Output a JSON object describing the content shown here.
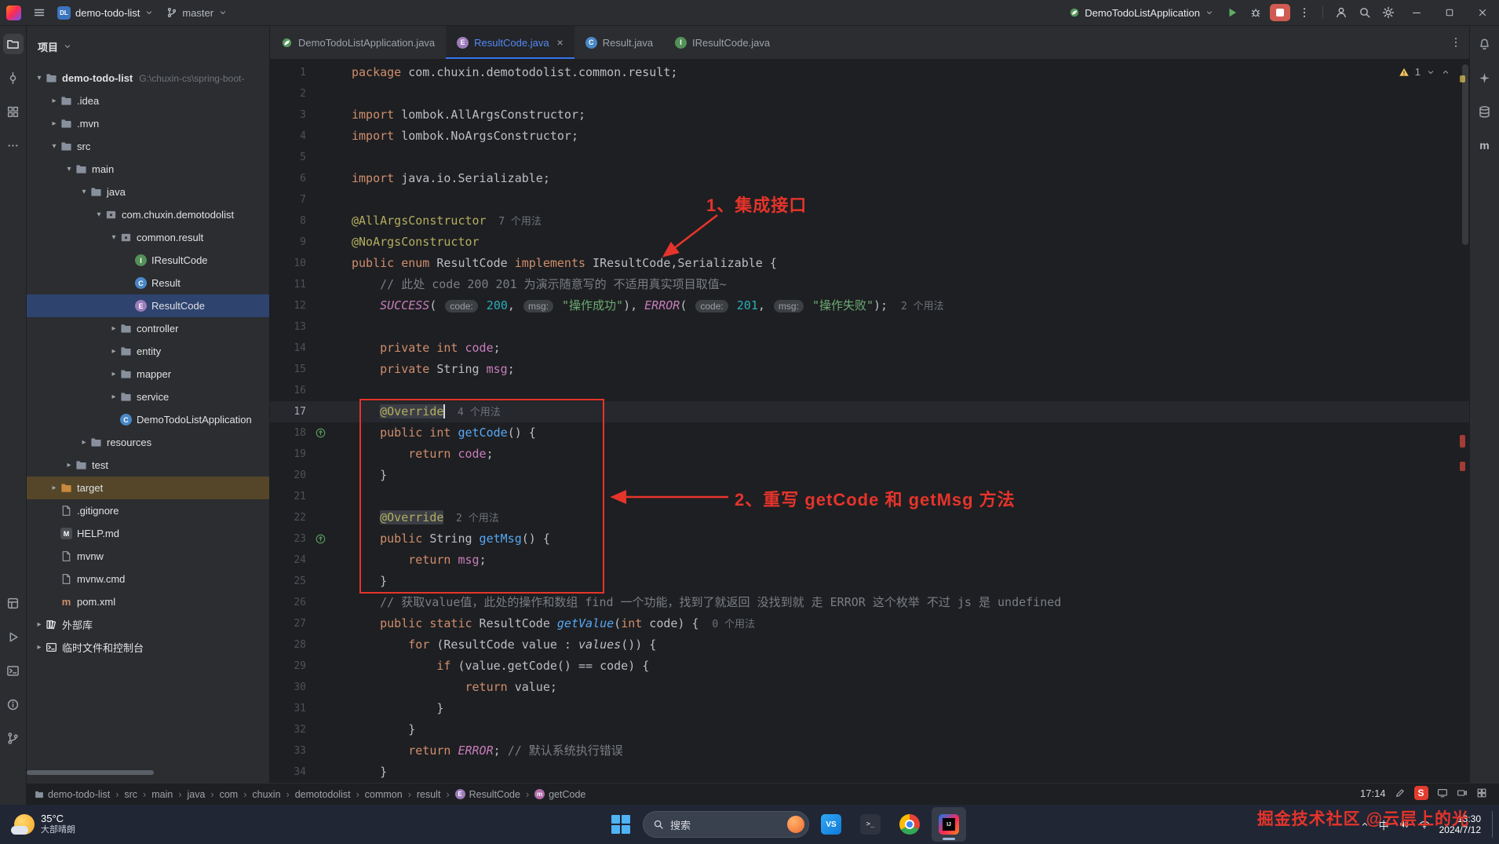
{
  "titlebar": {
    "project_badge": "DL",
    "project_name": "demo-todo-list",
    "branch": "master",
    "run_config": "DemoTodoListApplication"
  },
  "left_toolbar": {
    "top": [
      "project",
      "commit",
      "structure",
      "more"
    ],
    "bottom": [
      "services",
      "run",
      "terminal",
      "problems",
      "version-control"
    ]
  },
  "right_toolbar": {
    "top": [
      "notifications",
      "ai-assistant",
      "database",
      "maven"
    ],
    "maven_label": "m"
  },
  "project_panel": {
    "title": "项目",
    "tree": [
      {
        "label": "demo-todo-list",
        "path": "G:\\chuxin-cs\\spring-boot-",
        "depth": 0,
        "chev": "open",
        "icon": "folder",
        "bold": true
      },
      {
        "label": ".idea",
        "depth": 1,
        "chev": "closed",
        "icon": "folder"
      },
      {
        "label": ".mvn",
        "depth": 1,
        "chev": "closed",
        "icon": "folder"
      },
      {
        "label": "src",
        "depth": 1,
        "chev": "open",
        "icon": "folder"
      },
      {
        "label": "main",
        "depth": 2,
        "chev": "open",
        "icon": "folder"
      },
      {
        "label": "java",
        "depth": 3,
        "chev": "open",
        "icon": "folder"
      },
      {
        "label": "com.chuxin.demotodolist",
        "depth": 4,
        "chev": "open",
        "icon": "package"
      },
      {
        "label": "common.result",
        "depth": 5,
        "chev": "open",
        "icon": "package"
      },
      {
        "label": "IResultCode",
        "depth": 6,
        "icon": "interface"
      },
      {
        "label": "Result",
        "depth": 6,
        "icon": "class"
      },
      {
        "label": "ResultCode",
        "depth": 6,
        "icon": "enum",
        "selected": true
      },
      {
        "label": "controller",
        "depth": 5,
        "chev": "closed",
        "icon": "folder"
      },
      {
        "label": "entity",
        "depth": 5,
        "chev": "closed",
        "icon": "folder"
      },
      {
        "label": "mapper",
        "depth": 5,
        "chev": "closed",
        "icon": "folder"
      },
      {
        "label": "service",
        "depth": 5,
        "chev": "closed",
        "icon": "folder"
      },
      {
        "label": "DemoTodoListApplication",
        "depth": 5,
        "icon": "class"
      },
      {
        "label": "resources",
        "depth": 3,
        "chev": "closed",
        "icon": "folder"
      },
      {
        "label": "test",
        "depth": 2,
        "chev": "closed",
        "icon": "folder"
      },
      {
        "label": "target",
        "depth": 1,
        "chev": "closed",
        "icon": "folder",
        "variant": "target"
      },
      {
        "label": ".gitignore",
        "depth": 1,
        "icon": "file"
      },
      {
        "label": "HELP.md",
        "depth": 1,
        "icon": "md"
      },
      {
        "label": "mvnw",
        "depth": 1,
        "icon": "file"
      },
      {
        "label": "mvnw.cmd",
        "depth": 1,
        "icon": "file"
      },
      {
        "label": "pom.xml",
        "depth": 1,
        "icon": "maven"
      },
      {
        "label": "外部库",
        "depth": 0,
        "chev": "closed",
        "icon": "lib"
      },
      {
        "label": "临时文件和控制台",
        "depth": 0,
        "chev": "closed",
        "icon": "console"
      }
    ]
  },
  "editor": {
    "tabs": [
      {
        "label": "DemoTodoListApplication.java",
        "icon": "spring"
      },
      {
        "label": "ResultCode.java",
        "icon": "enum",
        "active": true
      },
      {
        "label": "Result.java",
        "icon": "class"
      },
      {
        "label": "IResultCode.java",
        "icon": "interface"
      }
    ],
    "inspection": {
      "warning_count": "1"
    },
    "annotations": {
      "label1": "1、集成接口",
      "label2": "2、重写 getCode 和 getMsg 方法"
    },
    "lines": [
      {
        "n": 1,
        "t": [
          [
            "kw",
            "package"
          ],
          [
            "pl",
            " com.chuxin.demotodolist.common.result;"
          ]
        ]
      },
      {
        "n": 2,
        "t": []
      },
      {
        "n": 3,
        "t": [
          [
            "kw",
            "import"
          ],
          [
            "pl",
            " lombok.AllArgsConstructor;"
          ]
        ]
      },
      {
        "n": 4,
        "t": [
          [
            "kw",
            "import"
          ],
          [
            "pl",
            " lombok.NoArgsConstructor;"
          ]
        ]
      },
      {
        "n": 5,
        "t": []
      },
      {
        "n": 6,
        "t": [
          [
            "kw",
            "import"
          ],
          [
            "pl",
            " java.io.Serializable;"
          ]
        ]
      },
      {
        "n": 7,
        "t": []
      },
      {
        "n": 8,
        "t": [
          [
            "an",
            "@AllArgsConstructor"
          ],
          [
            "us",
            "  7 个用法"
          ]
        ]
      },
      {
        "n": 9,
        "t": [
          [
            "an",
            "@NoArgsConstructor"
          ]
        ]
      },
      {
        "n": 10,
        "t": [
          [
            "kw",
            "public enum"
          ],
          [
            "pl",
            " ResultCode "
          ],
          [
            "kw",
            "implements"
          ],
          [
            "pl",
            " IResultCode,Serializable {"
          ]
        ]
      },
      {
        "n": 11,
        "t": [
          [
            "pl",
            "    "
          ],
          [
            "cm",
            "// 此处 code 200 201 为演示随意写的 不适用真实项目取值~"
          ]
        ]
      },
      {
        "n": 12,
        "t": [
          [
            "pl",
            "    "
          ],
          [
            "en",
            "SUCCESS"
          ],
          [
            "pl",
            "( "
          ],
          [
            "ih",
            "code:"
          ],
          [
            "nm",
            " 200"
          ],
          [
            "pl",
            ", "
          ],
          [
            "ih",
            "msg:"
          ],
          [
            "st",
            " \"操作成功\""
          ],
          [
            "pl",
            "), "
          ],
          [
            "en",
            "ERROR"
          ],
          [
            "pl",
            "( "
          ],
          [
            "ih",
            "code:"
          ],
          [
            "nm",
            " 201"
          ],
          [
            "pl",
            ", "
          ],
          [
            "ih",
            "msg:"
          ],
          [
            "st",
            " \"操作失败\""
          ],
          [
            "pl",
            "); "
          ],
          [
            "us",
            " 2 个用法"
          ]
        ]
      },
      {
        "n": 13,
        "t": []
      },
      {
        "n": 14,
        "t": [
          [
            "pl",
            "    "
          ],
          [
            "kw",
            "private int"
          ],
          [
            "fd",
            " code"
          ],
          [
            "pl",
            ";"
          ]
        ]
      },
      {
        "n": 15,
        "t": [
          [
            "pl",
            "    "
          ],
          [
            "kw",
            "private"
          ],
          [
            "pl",
            " String"
          ],
          [
            "fd",
            " msg"
          ],
          [
            "pl",
            ";"
          ]
        ]
      },
      {
        "n": 16,
        "t": []
      },
      {
        "n": 17,
        "cur": true,
        "t": [
          [
            "pl",
            "    "
          ],
          [
            "anhl",
            "@Override"
          ],
          [
            "caret",
            ""
          ],
          [
            "us",
            "  4 个用法"
          ]
        ]
      },
      {
        "n": 18,
        "g": "override",
        "t": [
          [
            "pl",
            "    "
          ],
          [
            "kw",
            "public int"
          ],
          [
            "mt",
            " getCode"
          ],
          [
            "pl",
            "() {"
          ]
        ]
      },
      {
        "n": 19,
        "t": [
          [
            "pl",
            "        "
          ],
          [
            "kw",
            "return"
          ],
          [
            "fd",
            " code"
          ],
          [
            "pl",
            ";"
          ]
        ]
      },
      {
        "n": 20,
        "t": [
          [
            "pl",
            "    }"
          ]
        ]
      },
      {
        "n": 21,
        "t": []
      },
      {
        "n": 22,
        "t": [
          [
            "pl",
            "    "
          ],
          [
            "anhl",
            "@Override"
          ],
          [
            "us",
            "  2 个用法"
          ]
        ]
      },
      {
        "n": 23,
        "g": "override",
        "t": [
          [
            "pl",
            "    "
          ],
          [
            "kw",
            "public"
          ],
          [
            "pl",
            " String"
          ],
          [
            "mt",
            " getMsg"
          ],
          [
            "pl",
            "() {"
          ]
        ]
      },
      {
        "n": 24,
        "t": [
          [
            "pl",
            "        "
          ],
          [
            "kw",
            "return"
          ],
          [
            "fd",
            " msg"
          ],
          [
            "pl",
            ";"
          ]
        ]
      },
      {
        "n": 25,
        "t": [
          [
            "pl",
            "    }"
          ]
        ]
      },
      {
        "n": 26,
        "t": [
          [
            "pl",
            "    "
          ],
          [
            "cm",
            "// 获取value值，此处的操作和数组 find 一个功能，找到了就返回 没找到就 走 ERROR 这个枚举 不过 js 是 undefined"
          ]
        ]
      },
      {
        "n": 27,
        "t": [
          [
            "pl",
            "    "
          ],
          [
            "kw",
            "public static"
          ],
          [
            "pl",
            " ResultCode "
          ],
          [
            "mti",
            "getValue"
          ],
          [
            "pl",
            "("
          ],
          [
            "kw",
            "int"
          ],
          [
            "pl",
            " code) { "
          ],
          [
            "us",
            " 0 个用法"
          ]
        ]
      },
      {
        "n": 28,
        "t": [
          [
            "pl",
            "        "
          ],
          [
            "kw",
            "for"
          ],
          [
            "pl",
            " (ResultCode value : "
          ],
          [
            "it",
            "values"
          ],
          [
            "pl",
            "()) {"
          ]
        ]
      },
      {
        "n": 29,
        "t": [
          [
            "pl",
            "            "
          ],
          [
            "kw",
            "if"
          ],
          [
            "pl",
            " (value.getCode() == code) {"
          ]
        ]
      },
      {
        "n": 30,
        "t": [
          [
            "pl",
            "                "
          ],
          [
            "kw",
            "return"
          ],
          [
            "pl",
            " value;"
          ]
        ]
      },
      {
        "n": 31,
        "t": [
          [
            "pl",
            "            }"
          ]
        ]
      },
      {
        "n": 32,
        "t": [
          [
            "pl",
            "        }"
          ]
        ]
      },
      {
        "n": 33,
        "t": [
          [
            "pl",
            "        "
          ],
          [
            "kw",
            "return"
          ],
          [
            "en",
            " ERROR"
          ],
          [
            "pl",
            "; "
          ],
          [
            "cm",
            "// 默认系统执行错误"
          ]
        ]
      },
      {
        "n": 34,
        "t": [
          [
            "pl",
            "    }"
          ]
        ]
      }
    ]
  },
  "breadcrumbs": [
    {
      "label": "demo-todo-list",
      "icon": "project"
    },
    {
      "label": "src"
    },
    {
      "label": "main"
    },
    {
      "label": "java"
    },
    {
      "label": "com"
    },
    {
      "label": "chuxin"
    },
    {
      "label": "demotodolist"
    },
    {
      "label": "common"
    },
    {
      "label": "result"
    },
    {
      "label": "ResultCode",
      "icon": "enum"
    },
    {
      "label": "getCode",
      "icon": "method"
    }
  ],
  "overlay": {
    "time": "17:14",
    "sogou_label": "S"
  },
  "watermark": "掘金技术社区 @云层上的光",
  "taskbar": {
    "weather_temp": "35°C",
    "weather_desc": "大部晴朗",
    "search_label": "搜索",
    "ime": "中",
    "clock_time": "13:30",
    "clock_date": "2024/7/12"
  }
}
